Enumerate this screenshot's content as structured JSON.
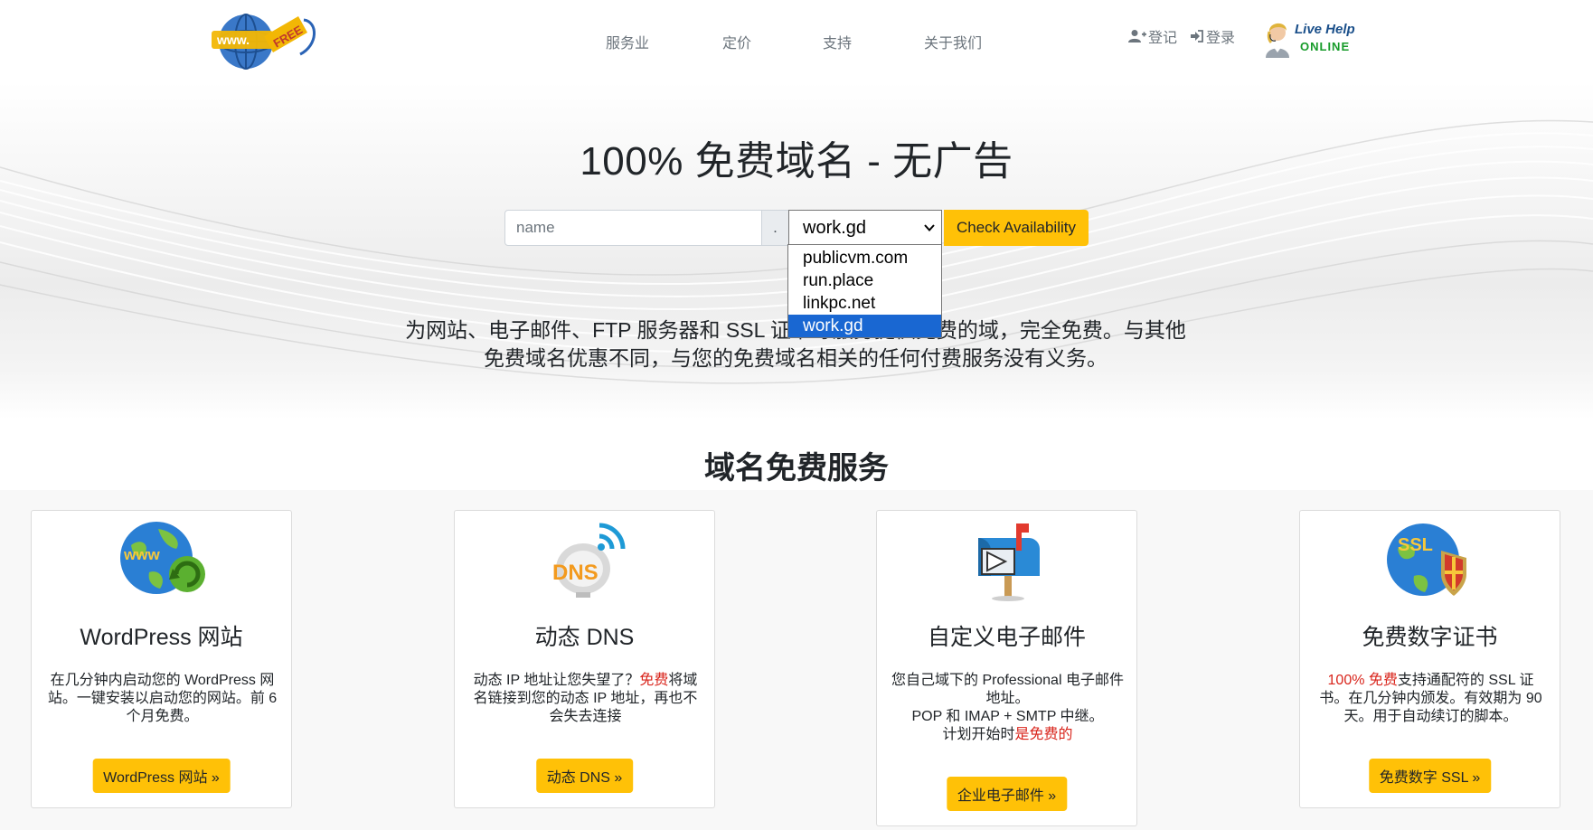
{
  "nav": {
    "items": [
      "服务业",
      "定价",
      "支持",
      "关于我们"
    ]
  },
  "account": {
    "register": "登记",
    "login": "登录"
  },
  "live_help": {
    "title": "Live Help",
    "status": "ONLINE"
  },
  "hero": {
    "title": "100% 免费域名 - 无广告",
    "name_placeholder": "name",
    "dot": ".",
    "selected_tld": "work.gd",
    "tld_options": [
      "publicvm.com",
      "run.place",
      "linkpc.net",
      "work.gd"
    ],
    "check_button": "Check Availability",
    "description": "为网站、电子邮件、FTP 服务器和 SSL 证书等服务提供免费的域，完全免费。与其他免费域名优惠不同，与您的免费域名相关的任何付费服务没有义务。"
  },
  "services": {
    "title": "域名免费服务",
    "cards": [
      {
        "title": "WordPress 网站",
        "text": "在几分钟内启动您的 WordPress 网站。一键安装以启动您的网站。前 6 个月免费。",
        "button": "WordPress 网站 »"
      },
      {
        "title": "动态 DNS",
        "text_before": "动态 IP 地址让您失望了？",
        "text_highlight": "免费",
        "text_after": "将域名链接到您的动态 IP 地址，再也不会失去连接",
        "button": "动态 DNS »"
      },
      {
        "title": "自定义电子邮件",
        "text_line1": "您自己域下的 Professional 电子邮件地址。",
        "text_line2": "POP 和 IMAP + SMTP 中继。",
        "text_before": "计划开始时",
        "text_highlight": "是免费的",
        "button": "企业电子邮件 »"
      },
      {
        "title": "免费数字证书",
        "text_highlight": "100% 免费",
        "text_after": "支持通配符的 SSL 证书。在几分钟内颁发。有效期为 90 天。用于自动续订的脚本。",
        "button": "免费数字 SSL »"
      }
    ]
  },
  "colors": {
    "accent": "#ffc107",
    "highlight_red": "#d9251c",
    "select_blue": "#1967d2"
  }
}
